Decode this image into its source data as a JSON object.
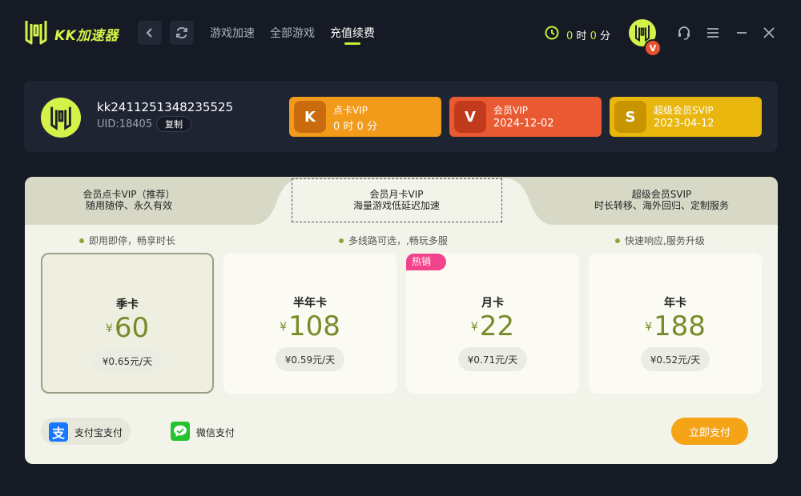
{
  "app": {
    "brand": "KK加速器"
  },
  "nav": {
    "tabs": [
      {
        "label": "游戏加速"
      },
      {
        "label": "全部游戏"
      },
      {
        "label": "充值续费"
      }
    ],
    "active_index": 2
  },
  "timer": {
    "hours": "0",
    "hours_unit": "时",
    "minutes": "0",
    "minutes_unit": "分"
  },
  "avatar_badge": "V",
  "user": {
    "username": "kk2411251348235525",
    "uid": "UID:18405",
    "copy_label": "复制"
  },
  "vip_cards": [
    {
      "title": "点卡VIP",
      "subtitle": "0 时 0 分",
      "icon_letter": "K",
      "color": "#f29a1a",
      "icon_color": "#c96b0e",
      "icon": "k-badge-icon"
    },
    {
      "title": "会员VIP",
      "subtitle": "2024-12-02",
      "icon_letter": "V",
      "color": "#ea5a32",
      "icon_color": "#c23a1c",
      "icon": "v-badge-icon"
    },
    {
      "title": "超级会员SVIP",
      "subtitle": "2023-04-12",
      "icon_letter": "S",
      "color": "#e8b60c",
      "icon_color": "#c89400",
      "icon": "s-badge-icon"
    }
  ],
  "plan_tabs": [
    {
      "line1": "会员点卡VIP（推荐）",
      "line2": "随用随停、永久有效"
    },
    {
      "line1": "会员月卡VIP",
      "line2": "海量游戏低延迟加速"
    },
    {
      "line1": "超级会员SVIP",
      "line2": "时长转移、海外回归、定制服务"
    }
  ],
  "active_plan_tab": 1,
  "features": [
    "即用即停，畅享时长",
    "多线路可选，,畅玩多服",
    "快速响应,服务升级"
  ],
  "packages": [
    {
      "name": "季卡",
      "currency": "¥",
      "price": "60",
      "per_day": "¥0.65元/天",
      "selected": true
    },
    {
      "name": "半年卡",
      "currency": "¥",
      "price": "108",
      "per_day": "¥0.59元/天"
    },
    {
      "name": "月卡",
      "currency": "¥",
      "price": "22",
      "per_day": "¥0.71元/天",
      "badge": "热销"
    },
    {
      "name": "年卡",
      "currency": "¥",
      "price": "188",
      "per_day": "¥0.52元/天"
    }
  ],
  "payment": {
    "alipay_label": "支付宝支付",
    "alipay_icon_char": "支",
    "wechat_label": "微信支付",
    "pay_button": "立即支付"
  },
  "colors": {
    "accent": "#c6ee3a",
    "brand": "#d4f24a",
    "price": "#7a8a2a",
    "pay_button": "#f5a418",
    "hot_badge": "#f2448c"
  }
}
